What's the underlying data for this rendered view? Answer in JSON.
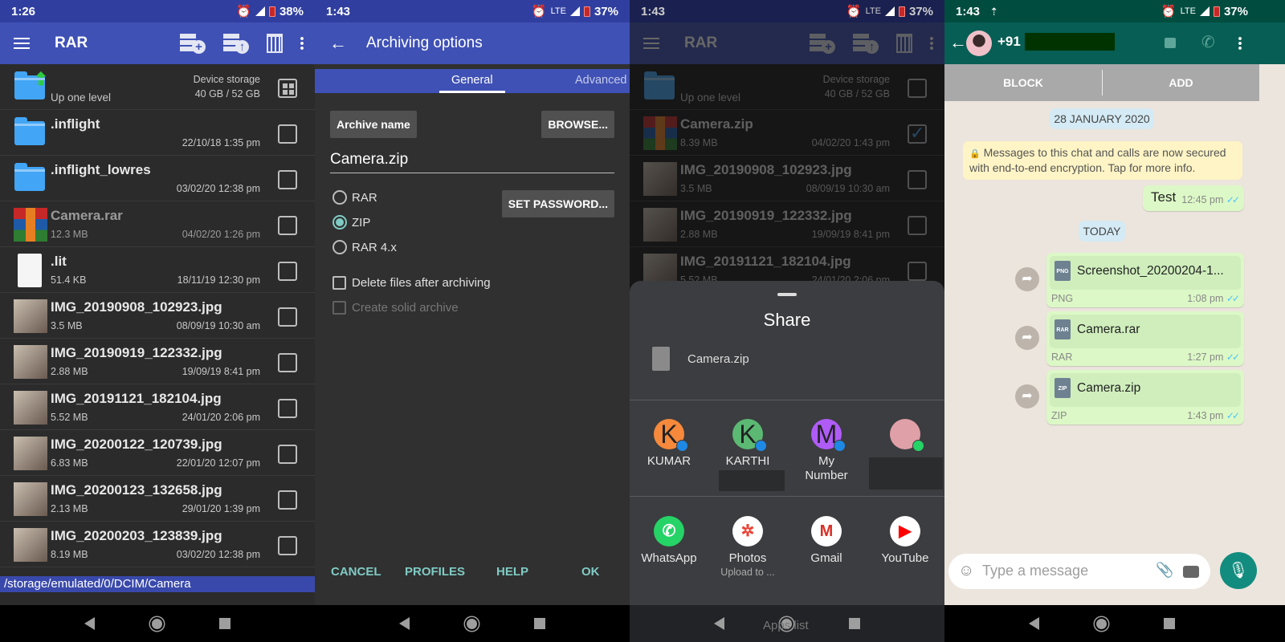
{
  "panel1": {
    "status": {
      "time": "1:26",
      "battery": "38%"
    },
    "toolbar": {
      "title": "RAR"
    },
    "up": {
      "label": "Up one level",
      "storage_label": "Device storage",
      "storage_value": "40 GB / 52 GB"
    },
    "files": [
      {
        "name": ".inflight",
        "size": "",
        "date": "22/10/18 1:35 pm",
        "kind": "folder"
      },
      {
        "name": ".inflight_lowres",
        "size": "",
        "date": "03/02/20 12:38 pm",
        "kind": "folder"
      },
      {
        "name": "Camera.rar",
        "size": "12.3 MB",
        "date": "04/02/20 1:26 pm",
        "kind": "rar"
      },
      {
        "name": ".lit",
        "size": "51.4 KB",
        "date": "18/11/19 12:30 pm",
        "kind": "file"
      },
      {
        "name": "IMG_20190908_102923.jpg",
        "size": "3.5 MB",
        "date": "08/09/19 10:30 am",
        "kind": "image"
      },
      {
        "name": "IMG_20190919_122332.jpg",
        "size": "2.88 MB",
        "date": "19/09/19 8:41 pm",
        "kind": "image"
      },
      {
        "name": "IMG_20191121_182104.jpg",
        "size": "5.52 MB",
        "date": "24/01/20 2:06 pm",
        "kind": "image"
      },
      {
        "name": "IMG_20200122_120739.jpg",
        "size": "6.83 MB",
        "date": "22/01/20 12:07 pm",
        "kind": "image"
      },
      {
        "name": "IMG_20200123_132658.jpg",
        "size": "2.13 MB",
        "date": "29/01/20 1:39 pm",
        "kind": "image"
      },
      {
        "name": "IMG_20200203_123839.jpg",
        "size": "8.19 MB",
        "date": "03/02/20 12:38 pm",
        "kind": "image"
      }
    ],
    "path": "/storage/emulated/0/DCIM/Camera"
  },
  "panel2": {
    "status": {
      "time": "1:43",
      "network": "LTE",
      "battery": "37%"
    },
    "title": "Archiving options",
    "tabs": [
      "General",
      "Advanced"
    ],
    "archive_name_label": "Archive name",
    "browse_label": "BROWSE...",
    "archive_name_value": "Camera.zip",
    "formats": [
      {
        "label": "RAR",
        "selected": false
      },
      {
        "label": "ZIP",
        "selected": true
      },
      {
        "label": "RAR 4.x",
        "selected": false
      }
    ],
    "set_password_label": "SET PASSWORD...",
    "delete_files_label": "Delete files after archiving",
    "solid_archive_label": "Create solid archive",
    "buttons": {
      "cancel": "CANCEL",
      "profiles": "PROFILES",
      "help": "HELP",
      "ok": "OK"
    }
  },
  "panel3": {
    "status": {
      "time": "1:43",
      "network": "LTE",
      "battery": "37%"
    },
    "toolbar": {
      "title": "RAR"
    },
    "up": {
      "label": "Up one level",
      "storage_label": "Device storage",
      "storage_value": "40 GB / 52 GB"
    },
    "files": [
      {
        "name": "Camera.zip",
        "size": "8.39 MB",
        "date": "04/02/20 1:43 pm",
        "checked": true
      },
      {
        "name": "IMG_20190908_102923.jpg",
        "size": "3.5 MB",
        "date": "08/09/19 10:30 am",
        "checked": false
      },
      {
        "name": "IMG_20190919_122332.jpg",
        "size": "2.88 MB",
        "date": "19/09/19 8:41 pm",
        "checked": false
      },
      {
        "name": "IMG_20191121_182104.jpg",
        "size": "5.52 MB",
        "date": "24/01/20 2:06 pm",
        "checked": false
      }
    ],
    "share": {
      "title": "Share",
      "file": "Camera.zip",
      "contacts": [
        {
          "initial": "K",
          "name": "KUMAR",
          "color": "#f6893b"
        },
        {
          "initial": "K",
          "name": "KARTHI",
          "color": "#5bb974"
        },
        {
          "initial": "M",
          "name": "My Number",
          "color": "#af5cf7"
        },
        {
          "initial": "",
          "name": "",
          "color": "#e0a0a8"
        }
      ],
      "apps": [
        {
          "name": "WhatsApp",
          "sub": ""
        },
        {
          "name": "Photos",
          "sub": "Upload to ..."
        },
        {
          "name": "Gmail",
          "sub": ""
        },
        {
          "name": "YouTube",
          "sub": ""
        }
      ],
      "apps_list_label": "Apps list"
    }
  },
  "panel4": {
    "status": {
      "time": "1:43",
      "network": "LTE",
      "battery": "37%"
    },
    "contact": "+91",
    "block_label": "BLOCK",
    "add_label": "ADD",
    "date_pill": "28 JANUARY 2020",
    "encryption_notice": "Messages to this chat and calls are now secured with end-to-end encryption. Tap for more info.",
    "messages": [
      {
        "text": "Test",
        "time": "12:45 pm"
      }
    ],
    "today_pill": "TODAY",
    "docs": [
      {
        "name": "Screenshot_20200204-1...",
        "type": "PNG",
        "time": "1:08 pm"
      },
      {
        "name": "Camera.rar",
        "type": "RAR",
        "time": "1:27 pm"
      },
      {
        "name": "Camera.zip",
        "type": "ZIP",
        "time": "1:43 pm"
      }
    ],
    "input_placeholder": "Type a message"
  },
  "colors": {
    "rar_blue": "#3f51b5",
    "teal_accent": "#80cbc4",
    "whatsapp_green": "#075e54",
    "bubble": "#dcf8c6"
  }
}
